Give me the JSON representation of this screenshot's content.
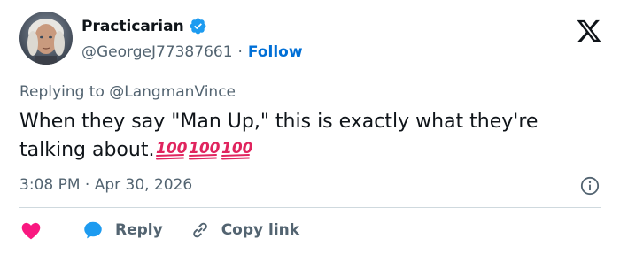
{
  "author": {
    "name": "Practicarian",
    "handle": "@GeorgeJ77387661",
    "separator": "·",
    "follow_label": "Follow"
  },
  "reply_context": {
    "prefix": "Replying to",
    "mention": "@LangmanVince"
  },
  "tweet": {
    "text": "When they say \"Man Up,\" this is exactly what they're talking about.",
    "emojis": [
      "100",
      "100",
      "100"
    ]
  },
  "meta": {
    "time": "3:08 PM",
    "separator": "·",
    "date": "Apr 30, 2026"
  },
  "actions": {
    "reply_label": "Reply",
    "copy_link_label": "Copy link"
  },
  "colors": {
    "verified": "#1d9bf0",
    "link": "#006fd6",
    "like": "#f91880",
    "reply_bubble": "#1d9bf0",
    "emoji": "#e0245e"
  },
  "icons": [
    "verified-badge-icon",
    "x-logo-icon",
    "info-icon",
    "heart-icon",
    "reply-bubble-icon",
    "link-icon",
    "hundred-points-emoji"
  ]
}
